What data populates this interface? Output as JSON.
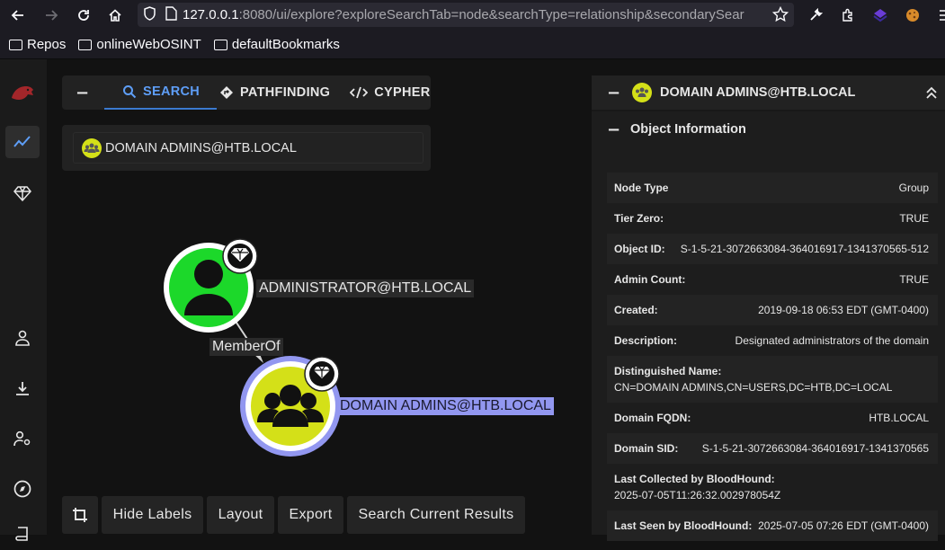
{
  "browser": {
    "url_host": "127.0.0.1",
    "url_rest": ":8080/ui/explore?exploreSearchTab=node&searchType=relationship&secondarySear",
    "bookmarks": [
      "Repos",
      "onlineWebOSINT",
      "defaultBookmarks"
    ]
  },
  "search_panel": {
    "collapse_symbol": "−",
    "tabs": [
      {
        "label": "SEARCH",
        "icon": "search-icon",
        "active": true
      },
      {
        "label": "PATHFINDING",
        "icon": "pathfinding-icon",
        "active": false
      },
      {
        "label": "CYPHER",
        "icon": "code-icon",
        "active": false
      }
    ],
    "result": "DOMAIN ADMINS@HTB.LOCAL"
  },
  "graph": {
    "nodes": [
      {
        "label": "ADMINISTRATOR@HTB.LOCAL",
        "type": "user",
        "color": "#1cd82a",
        "tier_zero": true
      },
      {
        "label": "DOMAIN ADMINS@HTB.LOCAL",
        "type": "group",
        "color": "#d4e018",
        "tier_zero": true,
        "selected": true
      }
    ],
    "edge": {
      "label": "MemberOf"
    }
  },
  "bottom_buttons": {
    "crop": "crop-icon",
    "hide_labels": "Hide Labels",
    "layout": "Layout",
    "export": "Export",
    "search_current": "Search Current Results"
  },
  "right_panel": {
    "title": "DOMAIN ADMINS@HTB.LOCAL",
    "section_title": "Object Information",
    "fields": [
      {
        "key": "Node Type",
        "value": "Group"
      },
      {
        "key": "Tier Zero:",
        "value": "TRUE"
      },
      {
        "key": "Object ID:",
        "value": "S-1-5-21-3072663084-364016917-1341370565-512"
      },
      {
        "key": "Admin Count:",
        "value": "TRUE"
      },
      {
        "key": "Created:",
        "value": "2019-09-18 06:53 EDT (GMT-0400)"
      },
      {
        "key": "Description:",
        "value": "Designated administrators of the domain"
      },
      {
        "key": "Distinguished Name:",
        "value": "CN=DOMAIN ADMINS,CN=USERS,DC=HTB,DC=LOCAL"
      },
      {
        "key": "Domain FQDN:",
        "value": "HTB.LOCAL"
      },
      {
        "key": "Domain SID:",
        "value": "S-1-5-21-3072663084-364016917-1341370565"
      },
      {
        "key": "Last Collected by BloodHound:",
        "value": "2025-07-05T11:26:32.002978054Z"
      },
      {
        "key": "Last Seen by BloodHound:",
        "value": "2025-07-05 07:26 EDT (GMT-0400)"
      }
    ]
  },
  "colors": {
    "accent": "#5e9ef7",
    "user_node": "#1cd82a",
    "group_node": "#d4e018",
    "selection": "#9297f0"
  }
}
